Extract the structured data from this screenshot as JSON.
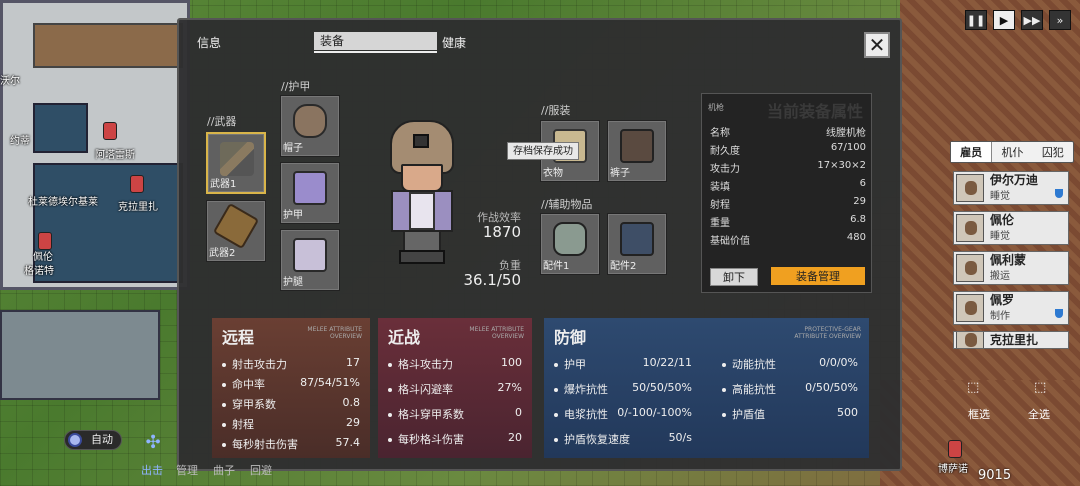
{
  "modal": {
    "tabs": {
      "info": "信息",
      "equip": "装备",
      "health": "健康"
    },
    "close": "✕"
  },
  "slots": {
    "weapon_section": "//武器",
    "armor_section": "//护甲",
    "clothing_section": "//服装",
    "aux_section": "//辅助物品",
    "weapon1": "武器1",
    "weapon2": "武器2",
    "hat": "帽子",
    "armor": "护甲",
    "legs": "护腿",
    "clothes": "衣物",
    "shoes": "裤子",
    "acc1": "配件1",
    "acc2": "配件2"
  },
  "character": {
    "efficiency_label": "作战效率",
    "efficiency_value": "1870",
    "load_label": "负重",
    "load_value": "36.1/50"
  },
  "tooltip": "存档保存成功",
  "attributes": {
    "tag": "机枪",
    "title": "当前装备属性",
    "rows": [
      {
        "k": "名称",
        "v": "线膛机枪"
      },
      {
        "k": "耐久度",
        "v": "67/100"
      },
      {
        "k": "攻击力",
        "v": "17×30×2"
      },
      {
        "k": "装填",
        "v": "6"
      },
      {
        "k": "射程",
        "v": "29"
      },
      {
        "k": "重量",
        "v": "6.8"
      },
      {
        "k": "基础价值",
        "v": "480"
      }
    ],
    "unequip": "卸下",
    "manage": "装备管理"
  },
  "ranged": {
    "title": "远程",
    "subtitle": "MELEE ATTRIBUTE OVERVIEW",
    "rows": [
      {
        "k": "射击攻击力",
        "v": "17"
      },
      {
        "k": "命中率",
        "v": "87/54/51%"
      },
      {
        "k": "穿甲系数",
        "v": "0.8"
      },
      {
        "k": "射程",
        "v": "29"
      },
      {
        "k": "每秒射击伤害",
        "v": "57.4"
      }
    ]
  },
  "melee": {
    "title": "近战",
    "subtitle": "MELEE ATTRIBUTE OVERVIEW",
    "rows": [
      {
        "k": "格斗攻击力",
        "v": "100"
      },
      {
        "k": "格斗闪避率",
        "v": "27%"
      },
      {
        "k": "格斗穿甲系数",
        "v": "0"
      },
      {
        "k": "每秒格斗伤害",
        "v": "20"
      }
    ]
  },
  "defense": {
    "title": "防御",
    "subtitle": "PROTECTIVE-GEAR ATTRIBUTE OVERVIEW",
    "left": [
      {
        "k": "护甲",
        "v": "10/22/11"
      },
      {
        "k": "爆炸抗性",
        "v": "50/50/50%"
      },
      {
        "k": "电浆抗性",
        "v": "0/-100/-100%"
      },
      {
        "k": "护盾恢复速度",
        "v": "50/s"
      }
    ],
    "right": [
      {
        "k": "动能抗性",
        "v": "0/0/0%"
      },
      {
        "k": "高能抗性",
        "v": "0/50/50%"
      },
      {
        "k": "护盾值",
        "v": "500"
      }
    ]
  },
  "sidebar": {
    "tabs": [
      "雇员",
      "机仆",
      "囚犯"
    ],
    "colonists": [
      {
        "name": "伊尔万迪",
        "status": "睡觉"
      },
      {
        "name": "佩伦",
        "status": "睡觉"
      },
      {
        "name": "佩利蒙",
        "status": "搬运"
      },
      {
        "name": "佩罗",
        "status": "制作"
      },
      {
        "name": "克拉里扎",
        "status": ""
      }
    ],
    "select_box": "框选",
    "select_all": "全选",
    "money": "9015"
  },
  "map_labels": {
    "l1": "阿塔雷斯",
    "l2": "杜莱德埃尔基莱",
    "l3": "克拉里扎",
    "l4": "佩伦",
    "l5": "格诺特",
    "l6": "博萨诺",
    "l7": "约蒂",
    "l8": "沃尔"
  },
  "bottom_bar": {
    "auto": "自动",
    "sortie": "出击",
    "n2": "管理",
    "n3": "曲子",
    "n4": "回避"
  }
}
